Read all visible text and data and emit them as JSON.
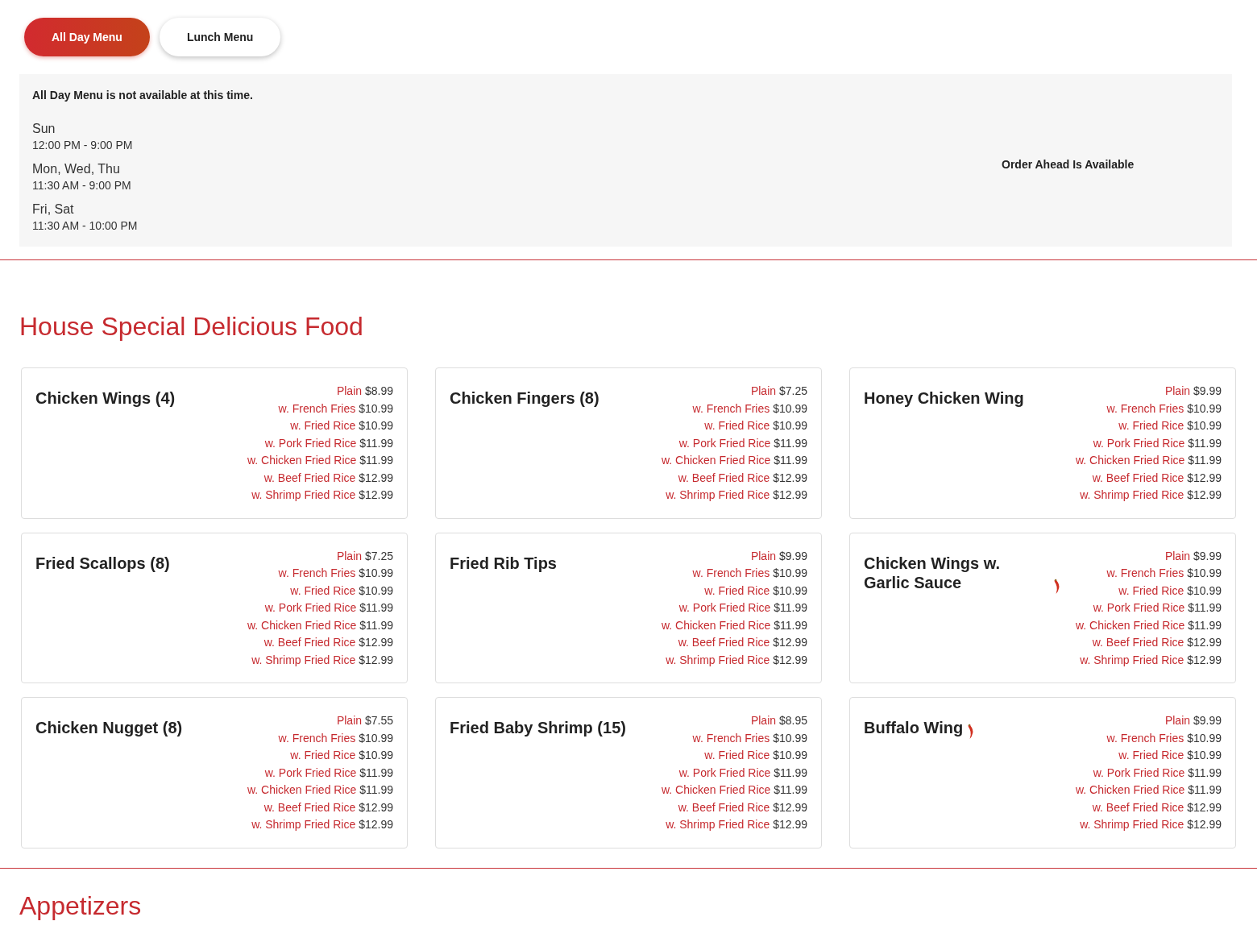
{
  "menu_tabs": [
    {
      "label": "All Day Menu",
      "selected": true
    },
    {
      "label": "Lunch Menu",
      "selected": false
    }
  ],
  "availability": {
    "notice": "All Day Menu is not available at this time.",
    "hours": [
      {
        "days": "Sun",
        "time": "12:00 PM - 9:00 PM"
      },
      {
        "days": "Mon, Wed, Thu",
        "time": "11:30 AM - 9:00 PM"
      },
      {
        "days": "Fri, Sat",
        "time": "11:30 AM - 10:00 PM"
      }
    ],
    "order_ahead": "Order Ahead Is Available"
  },
  "sections": [
    {
      "title": "House Special Delicious Food",
      "items": [
        {
          "name": "Chicken Wings (4)",
          "spicy": false,
          "prices": [
            {
              "option": "Plain",
              "price": "$8.99"
            },
            {
              "option": "w. French Fries",
              "price": "$10.99"
            },
            {
              "option": "w. Fried Rice",
              "price": "$10.99"
            },
            {
              "option": "w. Pork Fried Rice",
              "price": "$11.99"
            },
            {
              "option": "w. Chicken Fried Rice",
              "price": "$11.99"
            },
            {
              "option": "w. Beef Fried Rice",
              "price": "$12.99"
            },
            {
              "option": "w. Shrimp Fried Rice",
              "price": "$12.99"
            }
          ]
        },
        {
          "name": "Chicken Fingers (8)",
          "spicy": false,
          "prices": [
            {
              "option": "Plain",
              "price": "$7.25"
            },
            {
              "option": "w. French Fries",
              "price": "$10.99"
            },
            {
              "option": "w. Fried Rice",
              "price": "$10.99"
            },
            {
              "option": "w. Pork Fried Rice",
              "price": "$11.99"
            },
            {
              "option": "w. Chicken Fried Rice",
              "price": "$11.99"
            },
            {
              "option": "w. Beef Fried Rice",
              "price": "$12.99"
            },
            {
              "option": "w. Shrimp Fried Rice",
              "price": "$12.99"
            }
          ]
        },
        {
          "name": "Honey Chicken Wing",
          "spicy": false,
          "prices": [
            {
              "option": "Plain",
              "price": "$9.99"
            },
            {
              "option": "w. French Fries",
              "price": "$10.99"
            },
            {
              "option": "w. Fried Rice",
              "price": "$10.99"
            },
            {
              "option": "w. Pork Fried Rice",
              "price": "$11.99"
            },
            {
              "option": "w. Chicken Fried Rice",
              "price": "$11.99"
            },
            {
              "option": "w. Beef Fried Rice",
              "price": "$12.99"
            },
            {
              "option": "w. Shrimp Fried Rice",
              "price": "$12.99"
            }
          ]
        },
        {
          "name": "Fried Scallops (8)",
          "spicy": false,
          "prices": [
            {
              "option": "Plain",
              "price": "$7.25"
            },
            {
              "option": "w. French Fries",
              "price": "$10.99"
            },
            {
              "option": "w. Fried Rice",
              "price": "$10.99"
            },
            {
              "option": "w. Pork Fried Rice",
              "price": "$11.99"
            },
            {
              "option": "w. Chicken Fried Rice",
              "price": "$11.99"
            },
            {
              "option": "w. Beef Fried Rice",
              "price": "$12.99"
            },
            {
              "option": "w. Shrimp Fried Rice",
              "price": "$12.99"
            }
          ]
        },
        {
          "name": "Fried Rib Tips",
          "spicy": false,
          "prices": [
            {
              "option": "Plain",
              "price": "$9.99"
            },
            {
              "option": "w. French Fries",
              "price": "$10.99"
            },
            {
              "option": "w. Fried Rice",
              "price": "$10.99"
            },
            {
              "option": "w. Pork Fried Rice",
              "price": "$11.99"
            },
            {
              "option": "w. Chicken Fried Rice",
              "price": "$11.99"
            },
            {
              "option": "w. Beef Fried Rice",
              "price": "$12.99"
            },
            {
              "option": "w. Shrimp Fried Rice",
              "price": "$12.99"
            }
          ]
        },
        {
          "name": "Chicken Wings w. Garlic Sauce",
          "spicy": true,
          "prices": [
            {
              "option": "Plain",
              "price": "$9.99"
            },
            {
              "option": "w. French Fries",
              "price": "$10.99"
            },
            {
              "option": "w. Fried Rice",
              "price": "$10.99"
            },
            {
              "option": "w. Pork Fried Rice",
              "price": "$11.99"
            },
            {
              "option": "w. Chicken Fried Rice",
              "price": "$11.99"
            },
            {
              "option": "w. Beef Fried Rice",
              "price": "$12.99"
            },
            {
              "option": "w. Shrimp Fried Rice",
              "price": "$12.99"
            }
          ]
        },
        {
          "name": "Chicken Nugget (8)",
          "spicy": false,
          "prices": [
            {
              "option": "Plain",
              "price": "$7.55"
            },
            {
              "option": "w. French Fries",
              "price": "$10.99"
            },
            {
              "option": "w. Fried Rice",
              "price": "$10.99"
            },
            {
              "option": "w. Pork Fried Rice",
              "price": "$11.99"
            },
            {
              "option": "w. Chicken Fried Rice",
              "price": "$11.99"
            },
            {
              "option": "w. Beef Fried Rice",
              "price": "$12.99"
            },
            {
              "option": "w. Shrimp Fried Rice",
              "price": "$12.99"
            }
          ]
        },
        {
          "name": "Fried Baby Shrimp (15)",
          "spicy": false,
          "prices": [
            {
              "option": "Plain",
              "price": "$8.95"
            },
            {
              "option": "w. French Fries",
              "price": "$10.99"
            },
            {
              "option": "w. Fried Rice",
              "price": "$10.99"
            },
            {
              "option": "w. Pork Fried Rice",
              "price": "$11.99"
            },
            {
              "option": "w. Chicken Fried Rice",
              "price": "$11.99"
            },
            {
              "option": "w. Beef Fried Rice",
              "price": "$12.99"
            },
            {
              "option": "w. Shrimp Fried Rice",
              "price": "$12.99"
            }
          ]
        },
        {
          "name": "Buffalo Wing",
          "spicy": true,
          "prices": [
            {
              "option": "Plain",
              "price": "$9.99"
            },
            {
              "option": "w. French Fries",
              "price": "$10.99"
            },
            {
              "option": "w. Fried Rice",
              "price": "$10.99"
            },
            {
              "option": "w. Pork Fried Rice",
              "price": "$11.99"
            },
            {
              "option": "w. Chicken Fried Rice",
              "price": "$11.99"
            },
            {
              "option": "w. Beef Fried Rice",
              "price": "$12.99"
            },
            {
              "option": "w. Shrimp Fried Rice",
              "price": "$12.99"
            }
          ]
        }
      ]
    },
    {
      "title": "Appetizers"
    }
  ]
}
